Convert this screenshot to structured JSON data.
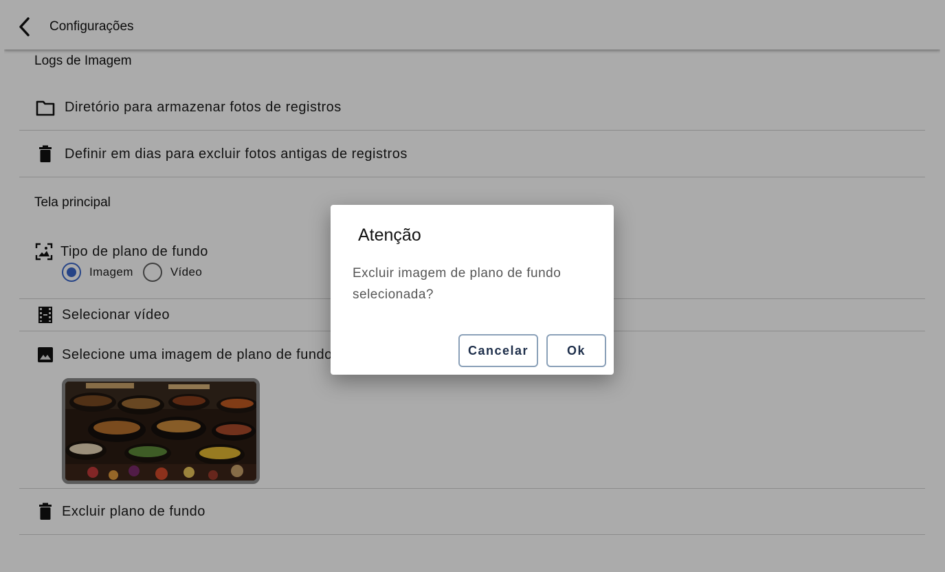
{
  "header": {
    "title": "Configurações"
  },
  "sections": {
    "logs_title": "Logs de Imagem",
    "logs_directory_label": "Diretório para armazenar fotos de registros",
    "logs_delete_days_label": "Definir em dias para excluir fotos antigas de registros",
    "main_title": "Tela principal",
    "bg_type_label": "Tipo de plano de fundo",
    "radio_image_label": "Imagem",
    "radio_video_label": "Vídeo",
    "radio_selected": "Imagem",
    "select_video_label": "Selecionar vídeo",
    "select_image_label": "Selecione uma imagem de plano de fundo",
    "delete_bg_label": "Excluir plano de fundo"
  },
  "dialog": {
    "title": "Atenção",
    "message": "Excluir imagem de plano de fundo selecionada?",
    "cancel_label": "Cancelar",
    "ok_label": "Ok"
  },
  "colors": {
    "accent": "#3a66c9",
    "button_text": "#1d2e4a",
    "overlay": "rgba(0,0,0,0.33)"
  },
  "icons": {
    "back": "chevron-left-icon",
    "folder": "folder-icon",
    "trash": "trash-icon",
    "wallpaper": "wallpaper-icon",
    "film": "film-icon",
    "image": "image-icon"
  }
}
